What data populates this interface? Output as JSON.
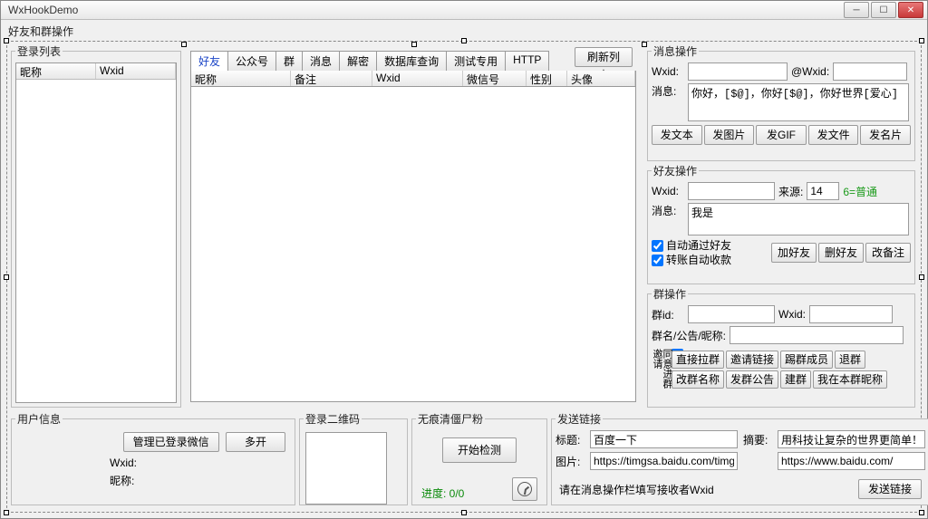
{
  "window": {
    "title": "WxHookDemo"
  },
  "section_top_label": "好友和群操作",
  "login_list": {
    "legend": "登录列表",
    "columns": [
      "昵称",
      "Wxid"
    ]
  },
  "center": {
    "refresh_btn": "刷新列表",
    "tabs": [
      "好友",
      "公众号",
      "群",
      "消息",
      "解密",
      "数据库查询",
      "测试专用",
      "HTTP"
    ],
    "active_tab_index": 0,
    "grid_columns": {
      "c0": "昵称",
      "c1": "备注",
      "c2": "Wxid",
      "c3": "微信号",
      "c4": "性别",
      "c5": "头像"
    }
  },
  "msg_ops": {
    "legend": "消息操作",
    "wxid_label": "Wxid:",
    "wxid_value": "",
    "atwxid_label": "@Wxid:",
    "atwxid_value": "",
    "msg_label": "消息:",
    "msg_value": "你好，[$@]，你好[$@]，你好世界[爱心]",
    "btns": {
      "text": "发文本",
      "img": "发图片",
      "gif": "发GIF",
      "file": "发文件",
      "card": "发名片"
    }
  },
  "friend_ops": {
    "legend": "好友操作",
    "wxid_label": "Wxid:",
    "wxid_value": "",
    "source_label": "来源:",
    "source_value": "14",
    "source_hint": "6=普通",
    "msg_label": "消息:",
    "msg_value": "我是",
    "chk_auto_accept": "自动通过好友",
    "chk_auto_collect": "转账自动收款",
    "btn_add": "加好友",
    "btn_del": "删好友",
    "btn_remark": "改备注"
  },
  "group_ops": {
    "legend": "群操作",
    "gid_label": "群id:",
    "gid_value": "",
    "wxid_label": "Wxid:",
    "wxid_value": "",
    "name_label": "群名/公告/昵称:",
    "name_value": "",
    "chk_agree": "同意进群邀请",
    "btns": {
      "pull": "直接拉群",
      "invite": "邀请链接",
      "kick": "踢群成员",
      "quit": "退群",
      "rename": "改群名称",
      "announce": "发群公告",
      "create": "建群",
      "mynick": "我在本群昵称"
    }
  },
  "user_info": {
    "legend": "用户信息",
    "btn_manage": "管理已登录微信",
    "btn_multi": "多开",
    "wxid_label": "Wxid:",
    "nick_label": "昵称:"
  },
  "qrcode": {
    "legend": "登录二维码"
  },
  "zombie": {
    "legend": "无痕清僵尸粉",
    "btn_start": "开始检测",
    "progress_label": "进度: ",
    "progress_value": "0/0"
  },
  "send_link": {
    "legend": "发送链接",
    "title_label": "标题:",
    "title_value": "百度一下",
    "summary_label": "摘要:",
    "summary_value": "用科技让复杂的世界更简单！",
    "img_label": "图片:",
    "img_value": "https://timgsa.baidu.com/timg",
    "url_value": "https://www.baidu.com/",
    "hint": "请在消息操作栏填写接收者Wxid",
    "btn_send": "发送链接"
  }
}
